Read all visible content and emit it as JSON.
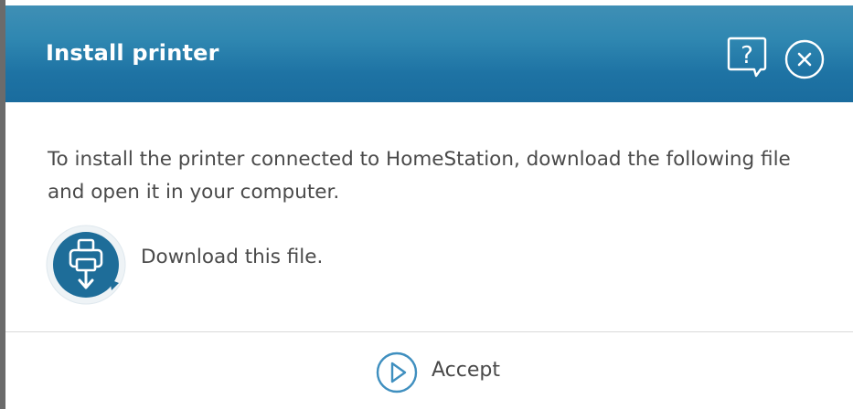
{
  "dialog": {
    "title": "Install printer",
    "help_icon": "help-icon",
    "close_icon": "close-icon"
  },
  "message": {
    "text": "To install the printer connected to HomeStation, download the following file and open it in your computer."
  },
  "download": {
    "icon": "printer-download-icon",
    "label": "Download this file."
  },
  "footer": {
    "accept_icon": "play-icon",
    "accept_label": "Accept"
  },
  "colors": {
    "header_top": "#3f8fb5",
    "header_bottom": "#1a6c9e",
    "text": "#4a4a4a",
    "icon_blue": "#1e6d99",
    "accept_icon": "#3f8fbf"
  }
}
